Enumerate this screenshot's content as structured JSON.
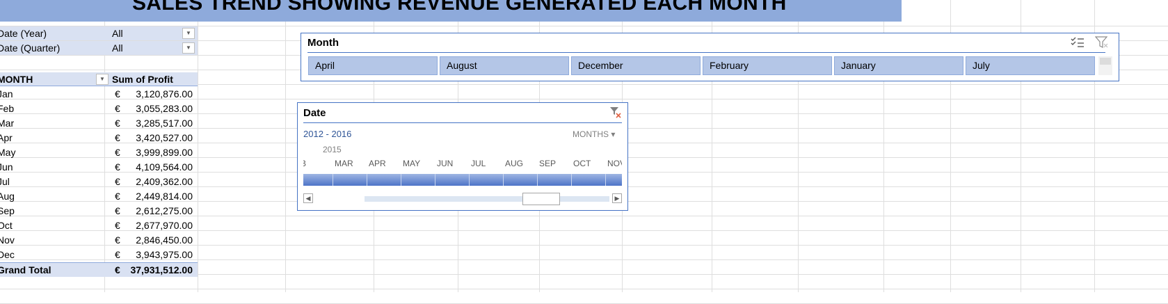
{
  "title": "SALES TREND SHOWING REVENUE GENERATED EACH MONTH",
  "filters": [
    {
      "label": "Date (Year)",
      "value": "All"
    },
    {
      "label": "Date (Quarter)",
      "value": "All"
    }
  ],
  "pivot": {
    "col_month": "MONTH",
    "col_profit": "Sum of Profit",
    "currency": "€",
    "rows": [
      {
        "month": "Jan",
        "amount": "3,120,876.00"
      },
      {
        "month": "Feb",
        "amount": "3,055,283.00"
      },
      {
        "month": "Mar",
        "amount": "3,285,517.00"
      },
      {
        "month": "Apr",
        "amount": "3,420,527.00"
      },
      {
        "month": "May",
        "amount": "3,999,899.00"
      },
      {
        "month": "Jun",
        "amount": "4,109,564.00"
      },
      {
        "month": "Jul",
        "amount": "2,409,362.00"
      },
      {
        "month": "Aug",
        "amount": "2,449,814.00"
      },
      {
        "month": "Sep",
        "amount": "2,612,275.00"
      },
      {
        "month": "Oct",
        "amount": "2,677,970.00"
      },
      {
        "month": "Nov",
        "amount": "2,846,450.00"
      },
      {
        "month": "Dec",
        "amount": "3,943,975.00"
      }
    ],
    "total_label": "Grand Total",
    "total_amount": "37,931,512.00"
  },
  "month_slicer": {
    "title": "Month",
    "items": [
      "April",
      "August",
      "December",
      "February",
      "January",
      "July"
    ],
    "icons": [
      "multi-select-icon",
      "clear-filter-icon"
    ]
  },
  "timeline": {
    "title": "Date",
    "range": "2012 - 2016",
    "level": "MONTHS",
    "year": "2015",
    "months": [
      "B",
      "MAR",
      "APR",
      "MAY",
      "JUN",
      "JUL",
      "AUG",
      "SEP",
      "OCT",
      "NOV"
    ],
    "icons": [
      "clear-filter-icon"
    ]
  },
  "colors": {
    "banner": "#8eaadb",
    "slicer_item": "#b4c6e7",
    "pivot_header": "#d9e1f2",
    "accent": "#4472c4"
  }
}
